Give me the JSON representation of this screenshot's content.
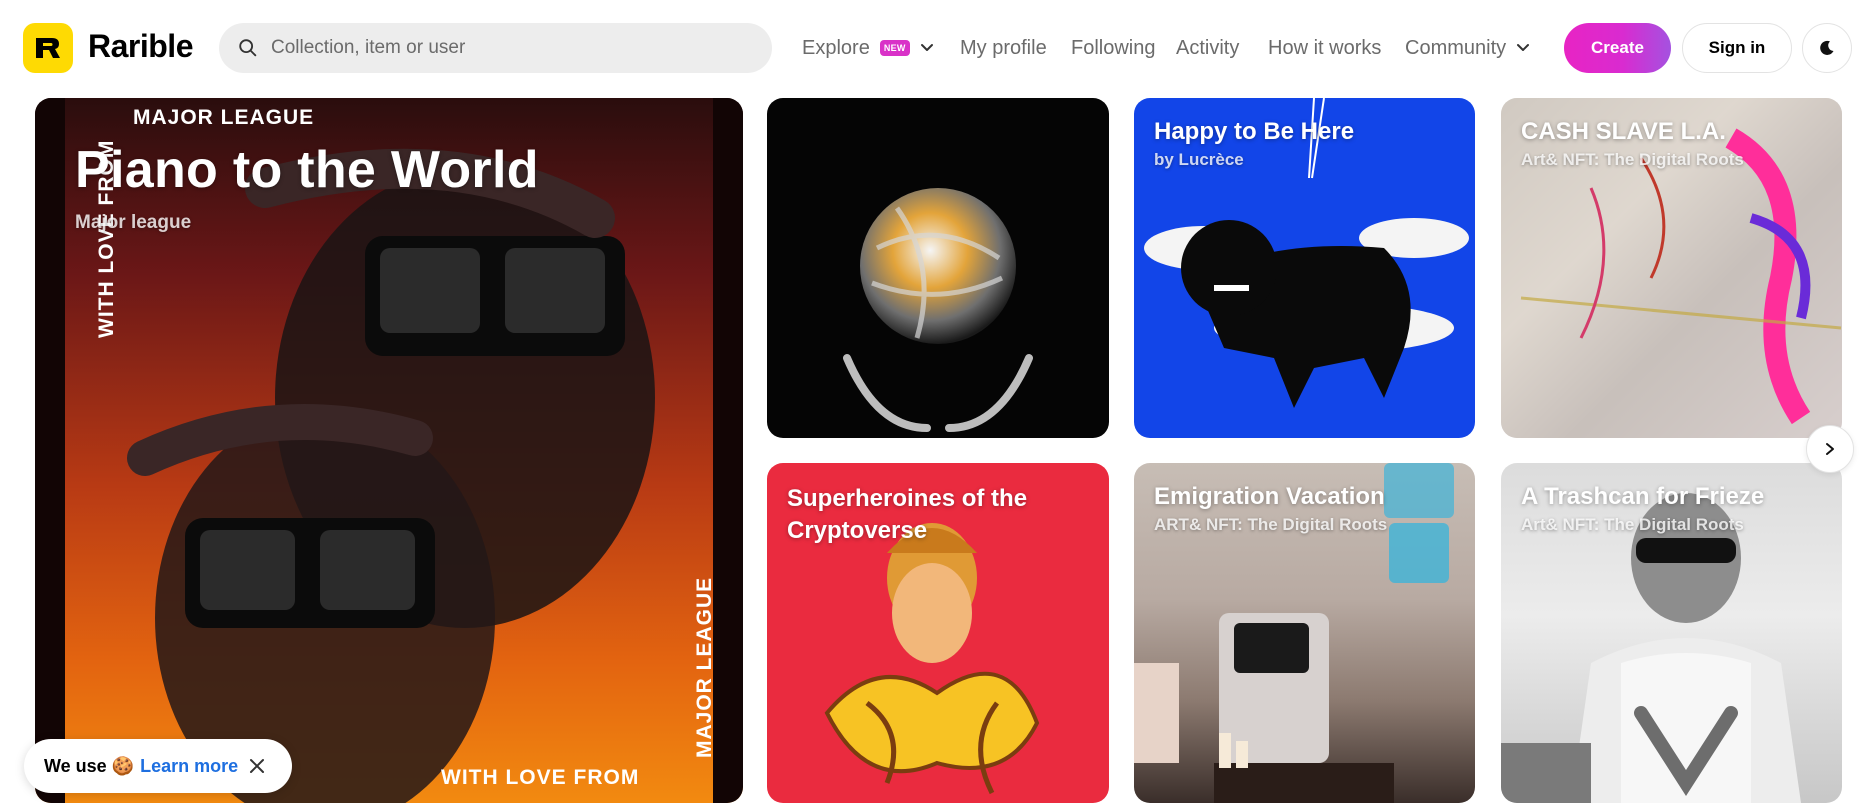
{
  "brand": {
    "name": "Rarible",
    "logo_letter": "R",
    "accent": "#FEDA03"
  },
  "search": {
    "placeholder": "Collection, item or user"
  },
  "nav": {
    "explore": "Explore",
    "new_badge": "NEW",
    "my_profile": "My profile",
    "following": "Following",
    "activity": "Activity",
    "how_it_works": "How it works",
    "community": "Community"
  },
  "actions": {
    "create": "Create",
    "sign_in": "Sign in",
    "create_color": "#e824c4"
  },
  "hero": {
    "title": "Piano to the World",
    "subtitle": "Major league",
    "art_text_top": "MAJOR LEAGUE",
    "art_text_bottom": "WITH LOVE FROM",
    "art_text_left": "WITH LOVE FROM",
    "art_text_right": "MAJOR LEAGUE"
  },
  "cards": [
    {
      "title": "",
      "subtitle": ""
    },
    {
      "title": "Happy to Be Here",
      "subtitle": "by Lucrèce"
    },
    {
      "title": "CASH SLAVE L.A.",
      "subtitle": "Art& NFT: The Digital Roots"
    },
    {
      "title": "Superheroines of the Cryptoverse",
      "subtitle": ""
    },
    {
      "title": "Emigration Vacation",
      "subtitle": "ART& NFT: The Digital Roots"
    },
    {
      "title": "A Trashcan for Frieze",
      "subtitle": "Art& NFT: The Digital Roots"
    }
  ],
  "cookie": {
    "text": "We use 🍪",
    "learn_more": "Learn more"
  },
  "icons": {
    "search": "search-icon",
    "chevron": "chevron-down-icon",
    "theme": "moon-icon",
    "next": "chevron-right-icon",
    "close": "close-icon"
  }
}
